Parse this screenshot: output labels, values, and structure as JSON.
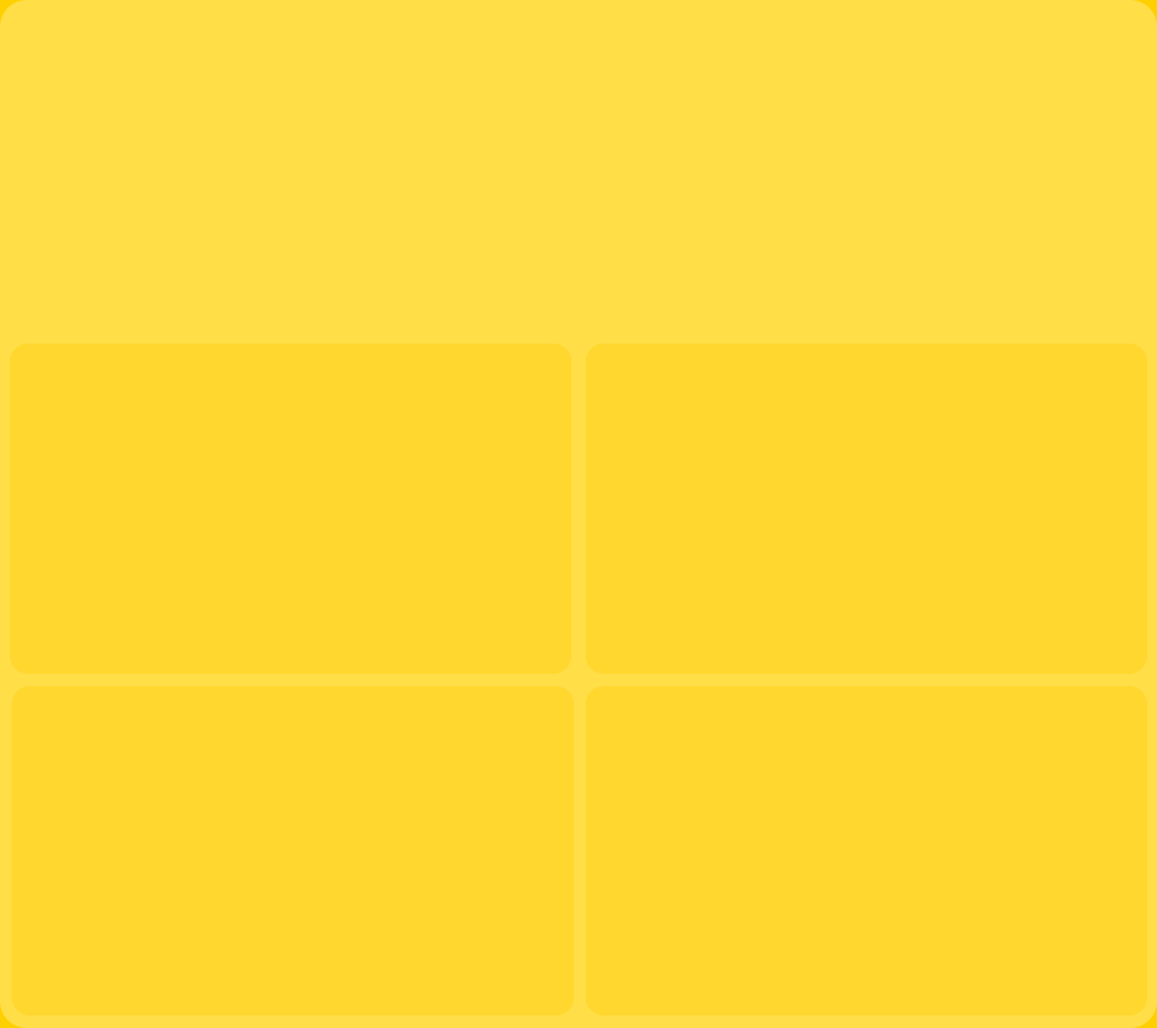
{
  "colors": {
    "outer_background": "#FFD000",
    "panel_background": "#FFDE48",
    "tile_background": "#FFD72E"
  },
  "tiles": [
    {
      "label": ""
    },
    {
      "label": ""
    },
    {
      "label": ""
    },
    {
      "label": ""
    }
  ]
}
